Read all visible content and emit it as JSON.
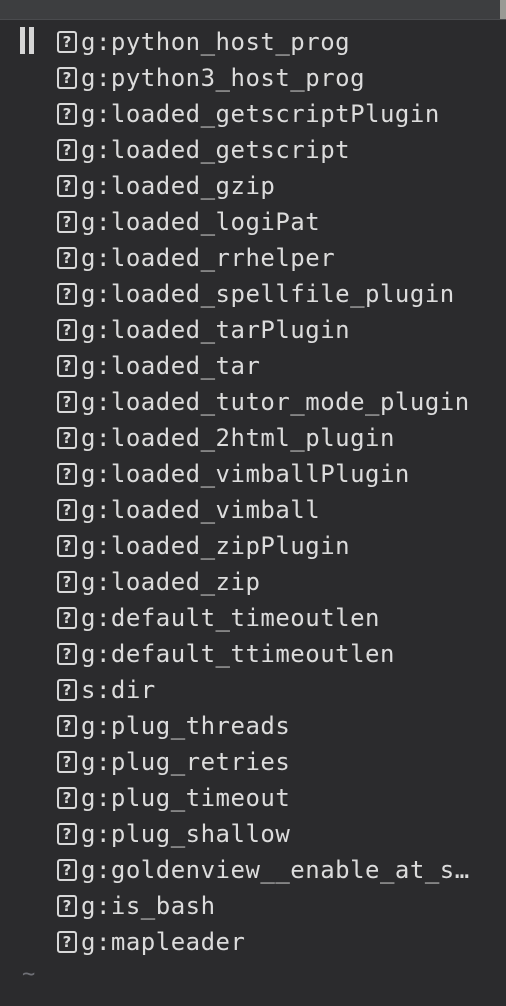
{
  "window": {
    "empty_line_marker": "~"
  },
  "variables": [
    {
      "icon": "question-mark-icon",
      "glyph": "?",
      "name": "g:python_host_prog"
    },
    {
      "icon": "question-mark-icon",
      "glyph": "?",
      "name": "g:python3_host_prog"
    },
    {
      "icon": "question-mark-icon",
      "glyph": "?",
      "name": "g:loaded_getscriptPlugin"
    },
    {
      "icon": "question-mark-icon",
      "glyph": "?",
      "name": "g:loaded_getscript"
    },
    {
      "icon": "question-mark-icon",
      "glyph": "?",
      "name": "g:loaded_gzip"
    },
    {
      "icon": "question-mark-icon",
      "glyph": "?",
      "name": "g:loaded_logiPat"
    },
    {
      "icon": "question-mark-icon",
      "glyph": "?",
      "name": "g:loaded_rrhelper"
    },
    {
      "icon": "question-mark-icon",
      "glyph": "?",
      "name": "g:loaded_spellfile_plugin"
    },
    {
      "icon": "question-mark-icon",
      "glyph": "?",
      "name": "g:loaded_tarPlugin"
    },
    {
      "icon": "question-mark-icon",
      "glyph": "?",
      "name": "g:loaded_tar"
    },
    {
      "icon": "question-mark-icon",
      "glyph": "?",
      "name": "g:loaded_tutor_mode_plugin"
    },
    {
      "icon": "question-mark-icon",
      "glyph": "?",
      "name": "g:loaded_2html_plugin"
    },
    {
      "icon": "question-mark-icon",
      "glyph": "?",
      "name": "g:loaded_vimballPlugin"
    },
    {
      "icon": "question-mark-icon",
      "glyph": "?",
      "name": "g:loaded_vimball"
    },
    {
      "icon": "question-mark-icon",
      "glyph": "?",
      "name": "g:loaded_zipPlugin"
    },
    {
      "icon": "question-mark-icon",
      "glyph": "?",
      "name": "g:loaded_zip"
    },
    {
      "icon": "question-mark-icon",
      "glyph": "?",
      "name": "g:default_timeoutlen"
    },
    {
      "icon": "question-mark-icon",
      "glyph": "?",
      "name": "g:default_ttimeoutlen"
    },
    {
      "icon": "question-mark-icon",
      "glyph": "?",
      "name": "s:dir"
    },
    {
      "icon": "question-mark-icon",
      "glyph": "?",
      "name": "g:plug_threads"
    },
    {
      "icon": "question-mark-icon",
      "glyph": "?",
      "name": "g:plug_retries"
    },
    {
      "icon": "question-mark-icon",
      "glyph": "?",
      "name": "g:plug_timeout"
    },
    {
      "icon": "question-mark-icon",
      "glyph": "?",
      "name": "g:plug_shallow"
    },
    {
      "icon": "question-mark-icon",
      "glyph": "?",
      "name": "g:goldenview__enable_at_s…"
    },
    {
      "icon": "question-mark-icon",
      "glyph": "?",
      "name": "g:is_bash"
    },
    {
      "icon": "question-mark-icon",
      "glyph": "?",
      "name": "g:mapleader"
    }
  ]
}
